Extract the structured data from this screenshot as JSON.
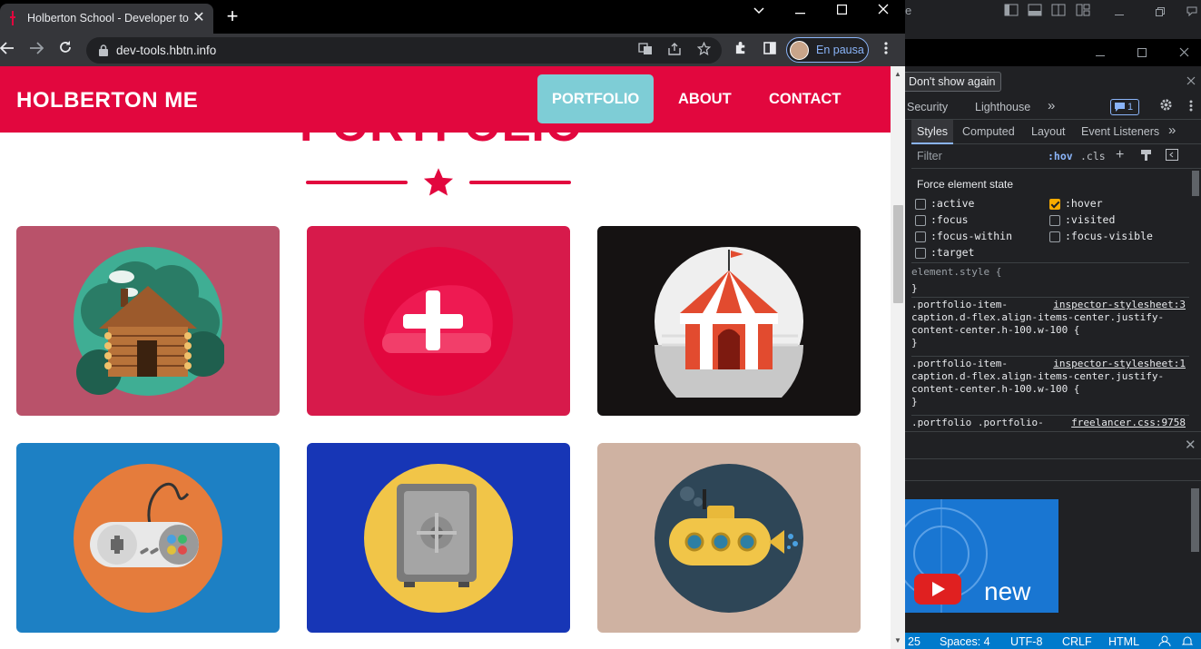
{
  "browser": {
    "tab_title": "Holberton School - Developer to",
    "tab_close": "✕",
    "new_tab": "+",
    "url": "dev-tools.hbtn.info",
    "profile_label": "En pausa"
  },
  "site": {
    "brand": "HOLBERTON ME",
    "nav": [
      {
        "label": "PORTFOLIO",
        "active": true
      },
      {
        "label": "ABOUT",
        "active": false
      },
      {
        "label": "CONTACT",
        "active": false
      }
    ],
    "section_title": "PORTFOLIO",
    "portfolio": [
      {
        "name": "cabin",
        "bg": "#b9526a",
        "circle": "#3fae94"
      },
      {
        "name": "cake",
        "bg": "#d71a4b",
        "circle": "#e2073e"
      },
      {
        "name": "circus",
        "bg": "#151212",
        "circle": "#efefef"
      },
      {
        "name": "game",
        "bg": "#1d80c4",
        "circle": "#e57c3c"
      },
      {
        "name": "safe",
        "bg": "#1736b6",
        "circle": "#f1c548"
      },
      {
        "name": "submarine",
        "bg": "#cfb2a2",
        "circle": "#2e4657"
      }
    ],
    "colors": {
      "brand_red": "#e2073e",
      "active_nav": "#7ecdd6"
    }
  },
  "devtools": {
    "partial_tab": "e",
    "dont_show": "Don't show again",
    "panel_tabs": [
      "Security",
      "Lighthouse",
      "»"
    ],
    "issues_count": "1",
    "sub_tabs": [
      "Styles",
      "Computed",
      "Layout",
      "Event Listeners",
      "»"
    ],
    "filter_placeholder": "Filter",
    "hov": ":hov",
    "cls": ".cls",
    "force_title": "Force element state",
    "states": [
      {
        "label": ":active",
        "checked": false
      },
      {
        "label": ":hover",
        "checked": true
      },
      {
        "label": ":focus",
        "checked": false
      },
      {
        "label": ":visited",
        "checked": false
      },
      {
        "label": ":focus-within",
        "checked": false
      },
      {
        "label": ":focus-visible",
        "checked": false
      },
      {
        "label": ":target",
        "checked": false
      }
    ],
    "rules": {
      "element_style": "element.style {",
      "close_brace": "}",
      "r1_l1": ".portfolio-item-",
      "r1_l2": "caption.d-flex.align-items-center.justify-",
      "r1_l3": "content-center.h-100.w-100 {",
      "r1_src": "inspector-stylesheet:3",
      "r2_src": "inspector-stylesheet:1",
      "r3_l1": ".portfolio .portfolio-",
      "r3_src": "freelancer.css:9758"
    },
    "drawer_close": "✕",
    "video_text": "new",
    "status": [
      "25",
      "Spaces: 4",
      "UTF-8",
      "CRLF",
      "HTML"
    ]
  }
}
